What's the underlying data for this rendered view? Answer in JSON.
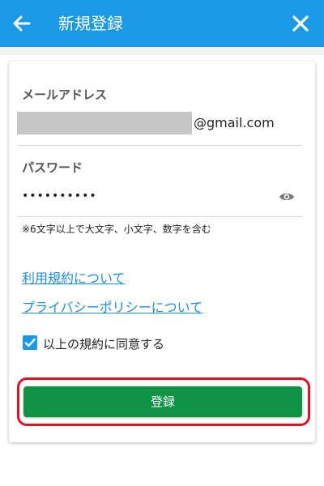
{
  "header": {
    "title": "新規登録",
    "back_icon": "arrow-left-icon",
    "close_icon": "close-icon",
    "color": "#1a9ae6"
  },
  "form": {
    "email": {
      "label": "メールアドレス",
      "value_suffix": "@gmail.com"
    },
    "password": {
      "label": "パスワード",
      "value": "••••••••••",
      "toggle_icon": "eye-icon",
      "hint": "※6文字以上で大文字、小文字、数字を含む"
    },
    "links": [
      {
        "label": "利用規約について"
      },
      {
        "label": "プライバシーポリシーについて"
      }
    ],
    "agreement": {
      "label": "以上の規約に同意する",
      "checked": true
    },
    "submit": {
      "label": "登録",
      "color": "#0e9244",
      "highlight_color": "#e01020"
    }
  }
}
